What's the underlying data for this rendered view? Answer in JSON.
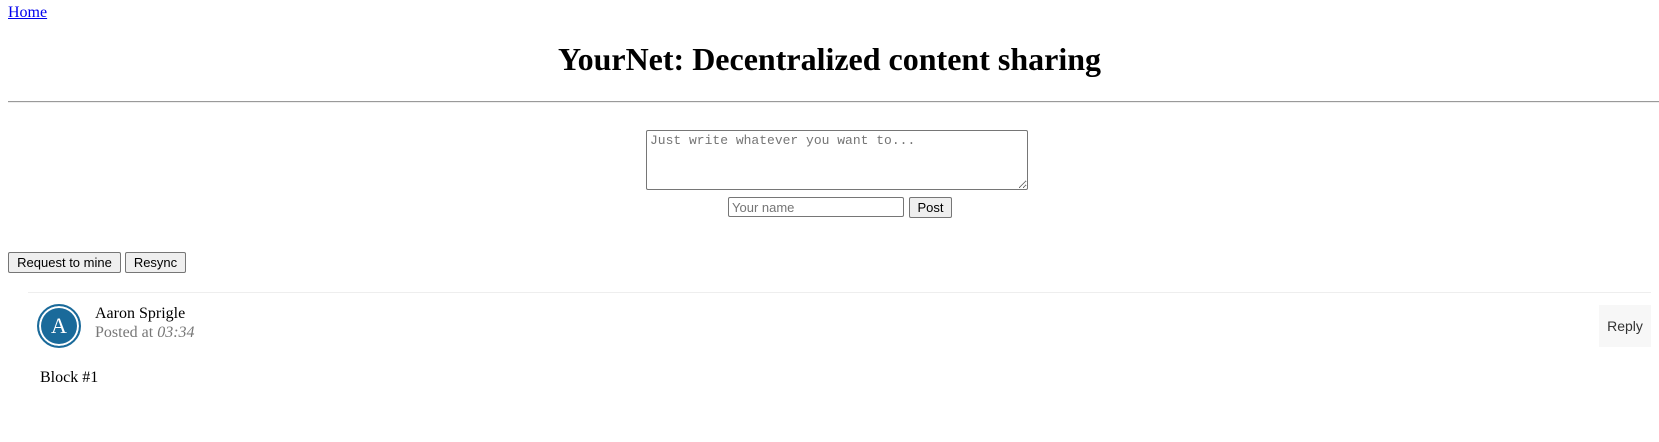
{
  "nav": {
    "home_label": "Home"
  },
  "header": {
    "title": "YourNet: Decentralized content sharing"
  },
  "compose": {
    "content_placeholder": "Just write whatever you want to...",
    "content_value": "",
    "name_placeholder": "Your name",
    "name_value": "",
    "post_label": "Post"
  },
  "actions": {
    "mine_label": "Request to mine",
    "resync_label": "Resync"
  },
  "posts": [
    {
      "avatar_letter": "A",
      "avatar_color": "#1a6a9a",
      "author": "Aaron Sprigle",
      "posted_prefix": "Posted at",
      "time": "03:34",
      "reply_label": "Reply",
      "content": "Block #1"
    }
  ]
}
